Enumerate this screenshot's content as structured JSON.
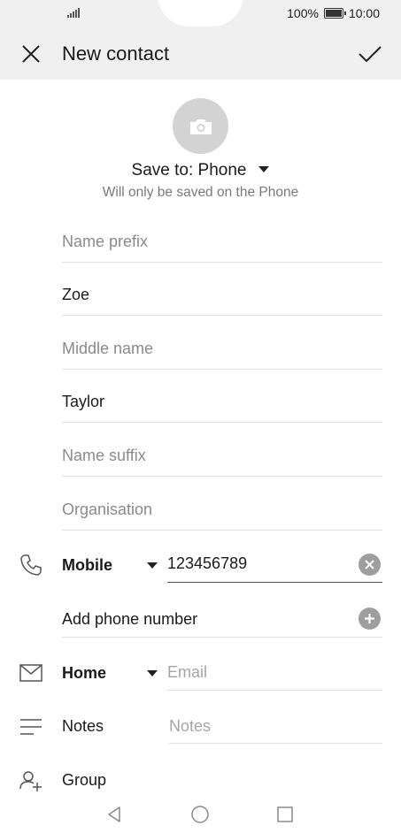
{
  "status_bar": {
    "battery": "100%",
    "time": "10:00"
  },
  "header": {
    "title": "New contact"
  },
  "photo": {
    "icon": "camera-icon"
  },
  "save_to": {
    "label": "Save to: Phone",
    "note": "Will only be saved on the Phone"
  },
  "fields": {
    "name_prefix": {
      "placeholder": "Name prefix"
    },
    "first_name": {
      "value": "Zoe"
    },
    "middle_name": {
      "placeholder": "Middle name"
    },
    "last_name": {
      "value": "Taylor"
    },
    "name_suffix": {
      "placeholder": "Name suffix"
    },
    "organisation": {
      "placeholder": "Organisation"
    }
  },
  "phone": {
    "type": "Mobile",
    "value": "123456789",
    "add_label": "Add phone number"
  },
  "email": {
    "type": "Home",
    "placeholder": "Email"
  },
  "notes": {
    "label": "Notes",
    "placeholder": "Notes"
  },
  "group": {
    "label": "Group"
  },
  "colors": {
    "header_bg": "#f0f0f0",
    "icon_grey": "#9e9e9e",
    "placeholder": "#8a8a8a"
  }
}
